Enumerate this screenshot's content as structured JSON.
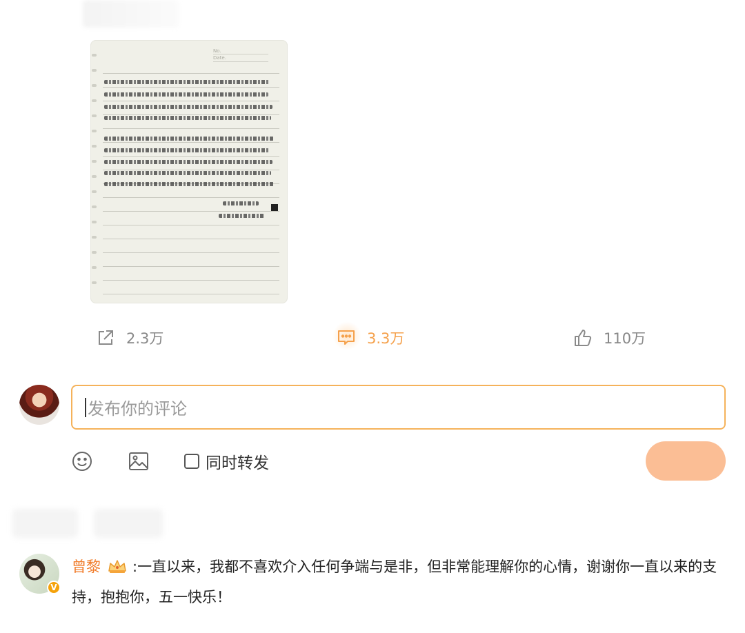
{
  "post": {
    "note_image_alt": "handwritten note",
    "note_signature": "十三州府戲",
    "note_date": "2025年4月30日"
  },
  "actions": {
    "share": {
      "icon": "share-icon",
      "count": "2.3万"
    },
    "comment": {
      "icon": "comment-icon",
      "count": "3.3万",
      "color": "#f5a04a"
    },
    "like": {
      "icon": "thumbs-up-icon",
      "count": "110万"
    }
  },
  "composer": {
    "placeholder": "发布你的评论",
    "repost_label": "同时转发",
    "repost_checked": false,
    "emoji_icon": "smiley-icon",
    "image_icon": "image-icon",
    "accent": "#f5b25a"
  },
  "reply": {
    "author": "曾黎",
    "text": ":一直以来，我都不喜欢介入任何争端与是非，但非常能理解你的心情，谢谢你一直以来的支持，抱抱你，五一快乐！",
    "name_color": "#f07b29"
  }
}
